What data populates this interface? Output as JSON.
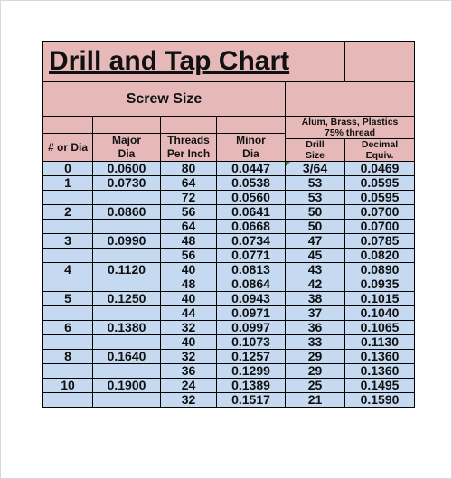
{
  "title": "Drill and Tap Chart",
  "section_label": "Screw Size",
  "material_header": "Alum, Brass, Plastics",
  "thread_header": "75% thread",
  "columns": {
    "number_or_dia": "# or Dia",
    "major_dia_1": "Major",
    "major_dia_2": "Dia",
    "threads_per_inch_1": "Threads",
    "threads_per_inch_2": "Per Inch",
    "minor_dia_1": "Minor",
    "minor_dia_2": "Dia",
    "drill_size_1": "Drill",
    "drill_size_2": "Size",
    "decimal_equiv_1": "Decimal",
    "decimal_equiv_2": "Equiv."
  },
  "rows": [
    {
      "size": "0",
      "major": "0.0600",
      "tpi": "80",
      "minor": "0.0447",
      "drill": "3/64",
      "decimal": "0.0469"
    },
    {
      "size": "1",
      "major": "0.0730",
      "tpi": "64",
      "minor": "0.0538",
      "drill": "53",
      "decimal": "0.0595"
    },
    {
      "size": "",
      "major": "",
      "tpi": "72",
      "minor": "0.0560",
      "drill": "53",
      "decimal": "0.0595"
    },
    {
      "size": "2",
      "major": "0.0860",
      "tpi": "56",
      "minor": "0.0641",
      "drill": "50",
      "decimal": "0.0700"
    },
    {
      "size": "",
      "major": "",
      "tpi": "64",
      "minor": "0.0668",
      "drill": "50",
      "decimal": "0.0700"
    },
    {
      "size": "3",
      "major": "0.0990",
      "tpi": "48",
      "minor": "0.0734",
      "drill": "47",
      "decimal": "0.0785"
    },
    {
      "size": "",
      "major": "",
      "tpi": "56",
      "minor": "0.0771",
      "drill": "45",
      "decimal": "0.0820"
    },
    {
      "size": "4",
      "major": "0.1120",
      "tpi": "40",
      "minor": "0.0813",
      "drill": "43",
      "decimal": "0.0890"
    },
    {
      "size": "",
      "major": "",
      "tpi": "48",
      "minor": "0.0864",
      "drill": "42",
      "decimal": "0.0935"
    },
    {
      "size": "5",
      "major": "0.1250",
      "tpi": "40",
      "minor": "0.0943",
      "drill": "38",
      "decimal": "0.1015"
    },
    {
      "size": "",
      "major": "",
      "tpi": "44",
      "minor": "0.0971",
      "drill": "37",
      "decimal": "0.1040"
    },
    {
      "size": "6",
      "major": "0.1380",
      "tpi": "32",
      "minor": "0.0997",
      "drill": "36",
      "decimal": "0.1065"
    },
    {
      "size": "",
      "major": "",
      "tpi": "40",
      "minor": "0.1073",
      "drill": "33",
      "decimal": "0.1130"
    },
    {
      "size": "8",
      "major": "0.1640",
      "tpi": "32",
      "minor": "0.1257",
      "drill": "29",
      "decimal": "0.1360"
    },
    {
      "size": "",
      "major": "",
      "tpi": "36",
      "minor": "0.1299",
      "drill": "29",
      "decimal": "0.1360"
    },
    {
      "size": "10",
      "major": "0.1900",
      "tpi": "24",
      "minor": "0.1389",
      "drill": "25",
      "decimal": "0.1495"
    },
    {
      "size": "",
      "major": "",
      "tpi": "32",
      "minor": "0.1517",
      "drill": "21",
      "decimal": "0.1590"
    }
  ],
  "colors": {
    "header_fill": "#e6b9b8",
    "data_fill": "#c5d9f1",
    "comment_marker": "#1e8c2e"
  }
}
